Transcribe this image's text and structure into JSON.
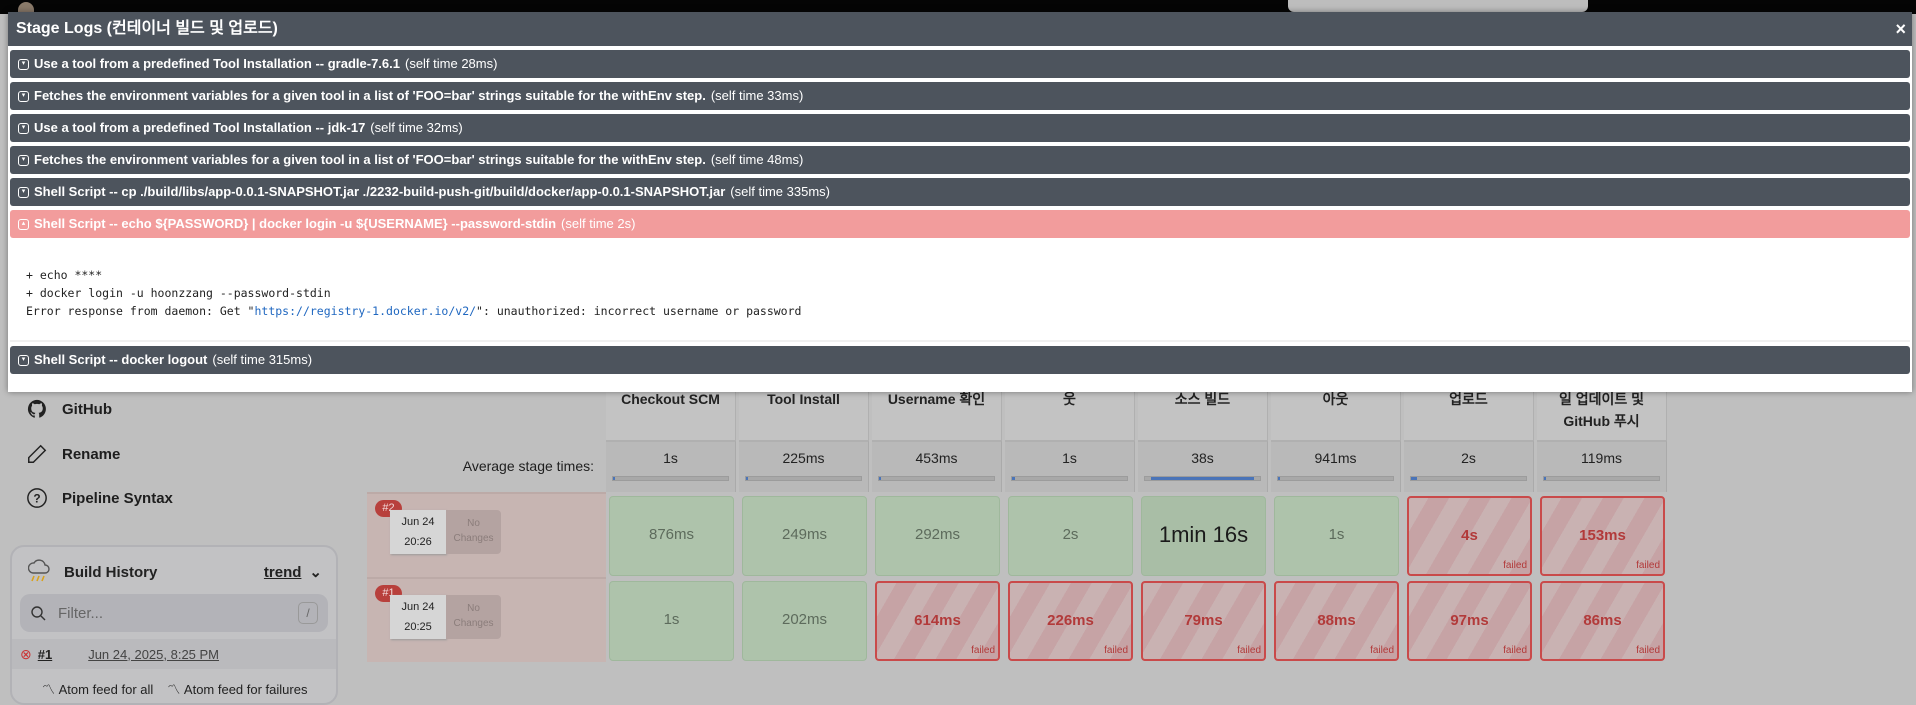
{
  "modal": {
    "title": "Stage Logs (컨테이너 빌드 및 업로드)",
    "close": "×",
    "steps": [
      {
        "label": "Use a tool from a predefined Tool Installation -- gradle-7.6.1",
        "time": "(self time 28ms)"
      },
      {
        "label": "Fetches the environment variables for a given tool in a list of 'FOO=bar' strings suitable for the withEnv step.",
        "time": "(self time 33ms)"
      },
      {
        "label": "Use a tool from a predefined Tool Installation -- jdk-17",
        "time": "(self time 32ms)"
      },
      {
        "label": "Fetches the environment variables for a given tool in a list of 'FOO=bar' strings suitable for the withEnv step.",
        "time": "(self time 48ms)"
      },
      {
        "label": "Shell Script -- cp ./build/libs/app-0.0.1-SNAPSHOT.jar ./2232-build-push-git/build/docker/app-0.0.1-SNAPSHOT.jar",
        "time": "(self time 335ms)"
      },
      {
        "label": "Shell Script -- echo ${PASSWORD} | docker login -u ${USERNAME} --password-stdin",
        "time": "(self time 2s)"
      },
      {
        "label": "Shell Script -- docker logout",
        "time": "(self time 315ms)"
      }
    ],
    "log": {
      "line1": "+ echo ****",
      "line2": "+ docker login -u hoonzzang --password-stdin",
      "line3_pre": "Error response from daemon: Get \"",
      "line3_link": "https://registry-1.docker.io/v2/",
      "line3_post": "\": unauthorized: incorrect username or password"
    }
  },
  "sidebar": {
    "items": [
      {
        "label": "GitHub"
      },
      {
        "label": "Rename"
      },
      {
        "label": "Pipeline Syntax"
      }
    ],
    "history": {
      "title": "Build History",
      "trend": "trend",
      "filter_placeholder": "Filter...",
      "shortcut": "/",
      "build_num": "#1",
      "build_date": "Jun 24, 2025, 8:25 PM",
      "feed_all": "Atom feed for all",
      "feed_failures": "Atom feed for failures"
    }
  },
  "stage_view": {
    "avg_label": "Average stage times:",
    "stages": [
      {
        "name": "Checkout SCM",
        "avg": "1s",
        "fill": 0.02
      },
      {
        "name": "Tool Install",
        "avg": "225ms",
        "fill": 0.01
      },
      {
        "name": "Username 확인",
        "avg": "453ms",
        "fill": 0.01
      },
      {
        "name": "웃",
        "avg": "1s",
        "fill": 0.03
      },
      {
        "name": "소스 빌드",
        "avg": "38s",
        "fill": 0.9
      },
      {
        "name": "아웃",
        "avg": "941ms",
        "fill": 0.02
      },
      {
        "name": "업로드",
        "avg": "2s",
        "fill": 0.05
      },
      {
        "name": "일 업데이트 및 GitHub 푸시",
        "avg": "119ms",
        "fill": 0.01
      }
    ],
    "builds": [
      {
        "num": "#2",
        "date": "Jun 24",
        "time": "20:26",
        "changes": "No Changes",
        "cells": [
          {
            "t": "876ms",
            "s": "ok"
          },
          {
            "t": "249ms",
            "s": "ok"
          },
          {
            "t": "292ms",
            "s": "ok"
          },
          {
            "t": "2s",
            "s": "ok"
          },
          {
            "t": "1min 16s",
            "s": "big"
          },
          {
            "t": "1s",
            "s": "ok"
          },
          {
            "t": "4s",
            "s": "fail"
          },
          {
            "t": "153ms",
            "s": "fail"
          }
        ]
      },
      {
        "num": "#1",
        "date": "Jun 24",
        "time": "20:25",
        "changes": "No Changes",
        "cells": [
          {
            "t": "1s",
            "s": "ok"
          },
          {
            "t": "202ms",
            "s": "ok"
          },
          {
            "t": "614ms",
            "s": "fail"
          },
          {
            "t": "226ms",
            "s": "fail"
          },
          {
            "t": "79ms",
            "s": "fail"
          },
          {
            "t": "88ms",
            "s": "fail"
          },
          {
            "t": "97ms",
            "s": "fail"
          },
          {
            "t": "86ms",
            "s": "fail"
          }
        ]
      }
    ],
    "failed_label": "failed"
  }
}
